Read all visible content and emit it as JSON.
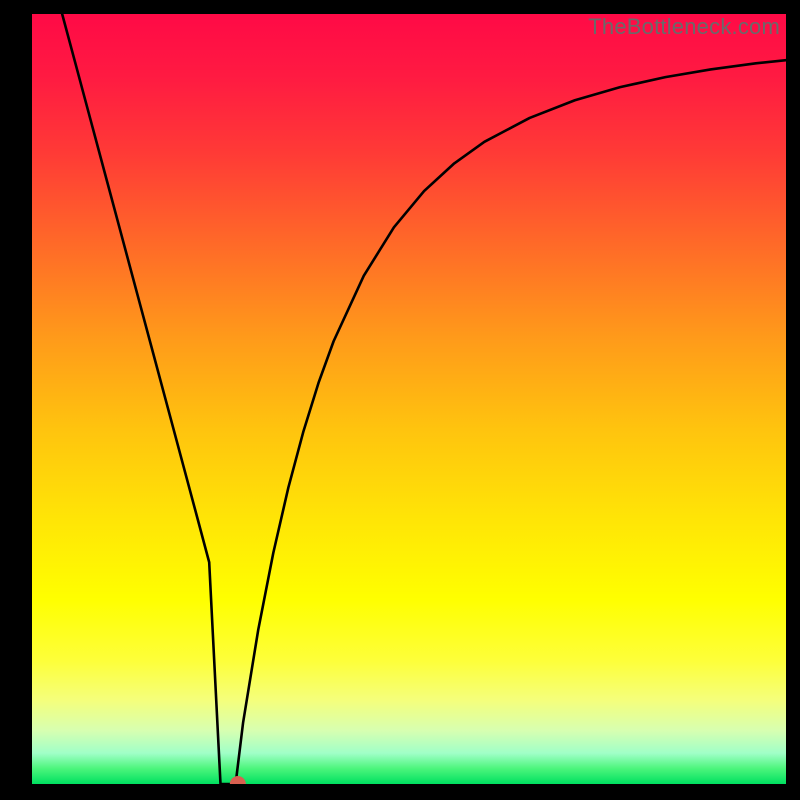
{
  "watermark": "TheBottleneck.com",
  "chart_data": {
    "type": "line",
    "title": "",
    "xlabel": "",
    "ylabel": "",
    "xlim": [
      0,
      100
    ],
    "ylim": [
      0,
      100
    ],
    "series": [
      {
        "name": "bottleneck-curve",
        "x": [
          4,
          6,
          8,
          10,
          12,
          14,
          16,
          18,
          20,
          22,
          23.5,
          25,
          26,
          27,
          28,
          30,
          32,
          34,
          36,
          38,
          40,
          44,
          48,
          52,
          56,
          60,
          66,
          72,
          78,
          84,
          90,
          96,
          100
        ],
        "y": [
          100,
          92.7,
          85.4,
          78.1,
          70.8,
          63.5,
          56.2,
          48.9,
          41.6,
          34.3,
          28.8,
          0,
          0,
          0,
          8,
          20,
          30,
          38.5,
          45.8,
          52.1,
          57.5,
          66.0,
          72.3,
          77.0,
          80.6,
          83.4,
          86.5,
          88.8,
          90.5,
          91.8,
          92.8,
          93.6,
          94.0
        ]
      }
    ],
    "marker": {
      "x": 27.3,
      "y": 0,
      "color": "#d86050",
      "radius_px": 8
    }
  }
}
